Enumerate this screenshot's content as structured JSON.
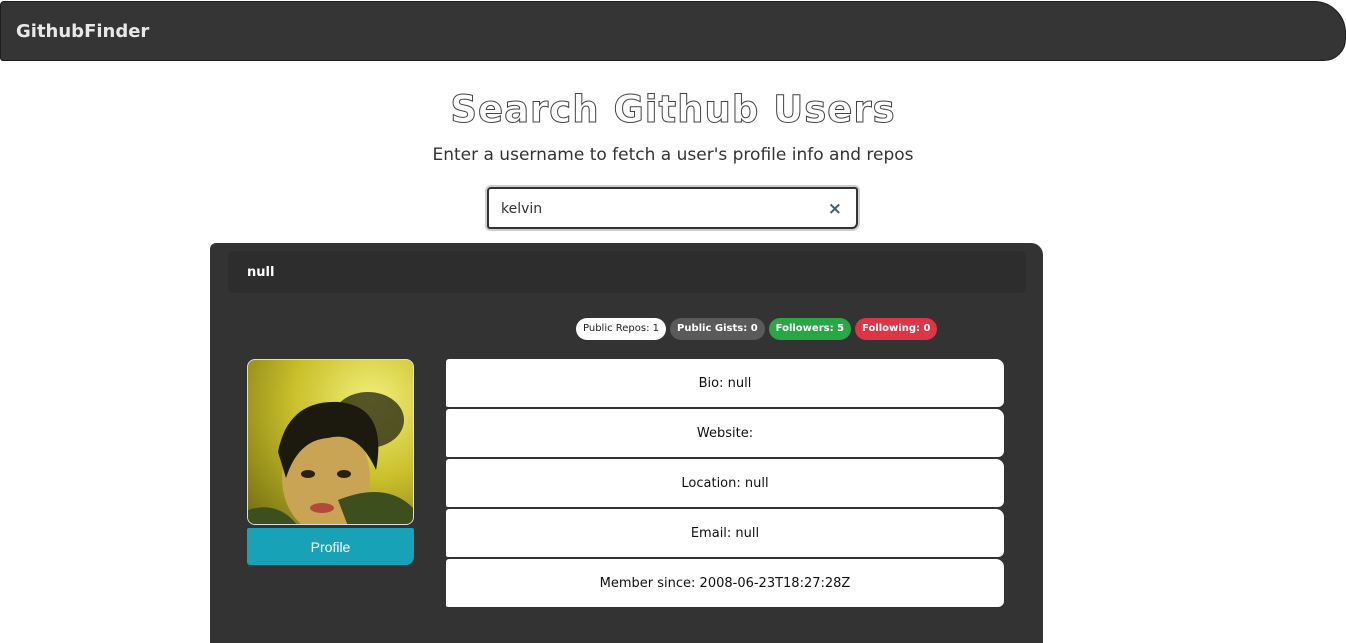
{
  "navbar": {
    "brand": "GithubFinder"
  },
  "header": {
    "title": "Search Github Users",
    "subtitle": "Enter a username to fetch a user's profile info and repos"
  },
  "search": {
    "value": "kelvin",
    "clear_icon": "×"
  },
  "user": {
    "name": "null",
    "badges": {
      "public_repos": "Public Repos: 1",
      "public_gists": "Public Gists: 0",
      "followers": "Followers: 5",
      "following": "Following: 0"
    },
    "profile_button": "Profile",
    "info": {
      "bio": "Bio: null",
      "website": "Website:",
      "location": "Location: null",
      "email": "Email: null",
      "member_since": "Member since: 2008-06-23T18:27:28Z"
    }
  },
  "colors": {
    "navbar": "#353535",
    "card": "#333333",
    "profile_button": "#17a2b8",
    "badge_green": "#28a745",
    "badge_red": "#dc3545",
    "clear_icon": "#3c5a8a"
  }
}
